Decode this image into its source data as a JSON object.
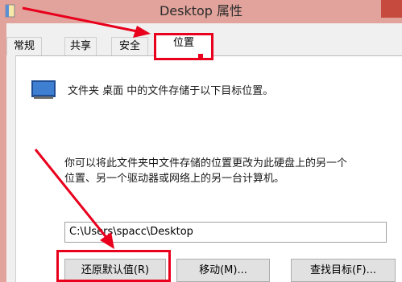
{
  "window": {
    "title": "Desktop 属性"
  },
  "tabs": [
    {
      "label": "常规"
    },
    {
      "label": "共享"
    },
    {
      "label": "安全"
    },
    {
      "label": "位置"
    }
  ],
  "location": {
    "description": "文件夹 桌面 中的文件存储于以下目标位置。",
    "hint_line1": "你可以将此文件夹中文件存储的位置更改为此硬盘上的另一个",
    "hint_line2": "位置、另一个驱动器或网络上的另一台计算机。",
    "path_value": "C:\\Users\\spacc\\Desktop"
  },
  "buttons": {
    "restore_default": "还原默认值(R)",
    "move": "移动(M)...",
    "find_target": "查找目标(F)..."
  },
  "colors": {
    "annotation": "#e8001c",
    "title_bar": "#e1a39c",
    "close_button": "#c64a3e"
  }
}
